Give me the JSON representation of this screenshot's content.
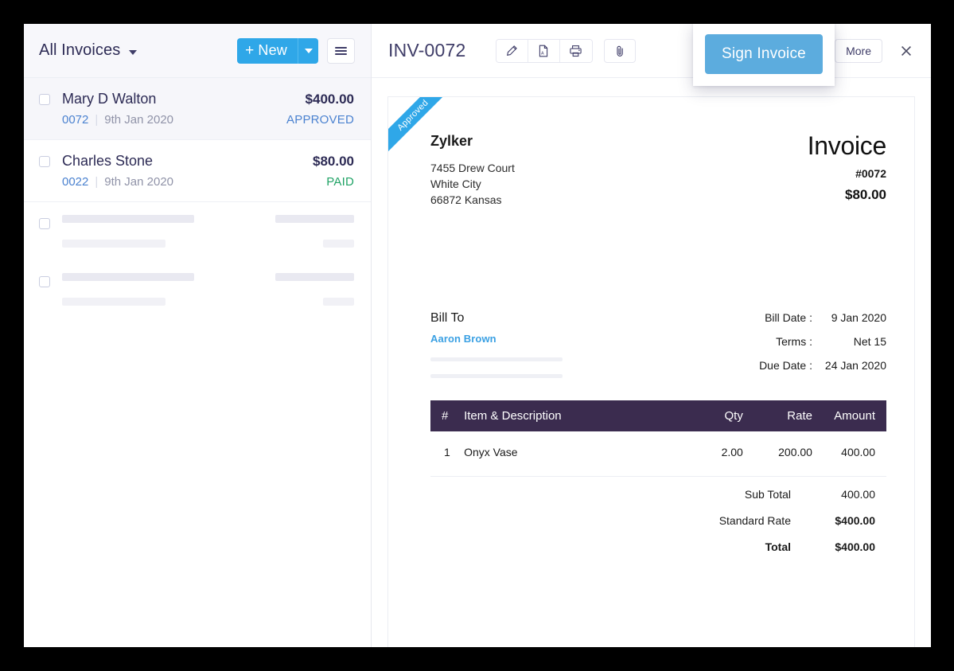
{
  "sidebar": {
    "list_title": "All Invoices",
    "new_button_label": "New",
    "new_button_plus": "+",
    "invoices": [
      {
        "name": "Mary D Walton",
        "amount": "$400.00",
        "number": "0072",
        "separator": "|",
        "date": "9th Jan 2020",
        "status": "APPROVED",
        "status_color": "#4b82d0"
      },
      {
        "name": "Charles Stone",
        "amount": "$80.00",
        "number": "0022",
        "separator": "|",
        "date": "9th Jan 2020",
        "status": "PAID",
        "status_color": "#21a366"
      }
    ]
  },
  "detail": {
    "doc_title": "INV-0072",
    "toolbar_icons": [
      "edit-pencil-icon",
      "pdf-file-icon",
      "printer-icon",
      "attachment-paperclip-icon"
    ],
    "sign_invoice_label": "Sign Invoice",
    "more_label": "More",
    "close_icon": "close-x-icon"
  },
  "invoice": {
    "ribbon": "Approved",
    "org_name": "Zylker",
    "org_address_line1": "7455 Drew Court",
    "org_address_line2": "White City",
    "org_address_line3": "66872 Kansas",
    "heading": "Invoice",
    "number": "#0072",
    "header_amount": "$80.00",
    "bill_to_label": "Bill To",
    "bill_to_name": "Aaron Brown",
    "dates": [
      {
        "label": "Bill Date :",
        "value": "9 Jan 2020"
      },
      {
        "label": "Terms :",
        "value": "Net 15"
      },
      {
        "label": "Due Date :",
        "value": "24 Jan 2020"
      }
    ],
    "table": {
      "headers": [
        "#",
        "Item & Description",
        "Qty",
        "Rate",
        "Amount"
      ],
      "rows": [
        {
          "idx": "1",
          "description": "Onyx Vase",
          "qty": "2.00",
          "rate": "200.00",
          "amount": "400.00"
        }
      ]
    },
    "totals": [
      {
        "label": "Sub Total",
        "value": "400.00",
        "emphasis": "none"
      },
      {
        "label": "Standard Rate",
        "value": "$400.00",
        "emphasis": "value"
      },
      {
        "label": "Total",
        "value": "$400.00",
        "emphasis": "both"
      }
    ]
  },
  "colors": {
    "accent_blue": "#2fa7e8",
    "sign_button_blue": "#5cacde",
    "table_header": "#3b2c4f",
    "text_dark": "#2d2b55",
    "status_approved": "#4b82d0",
    "status_paid": "#21a366"
  }
}
